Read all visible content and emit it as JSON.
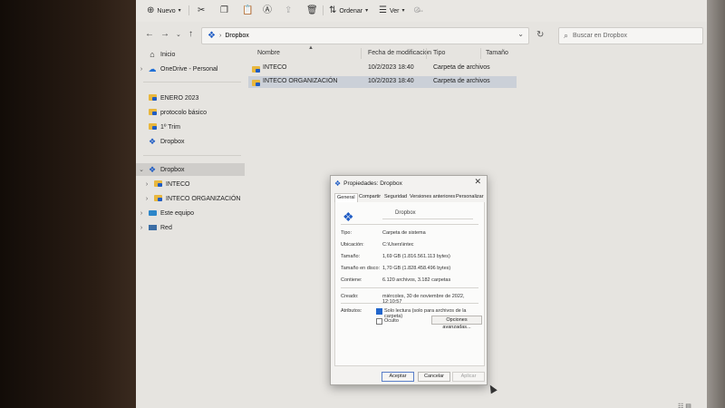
{
  "toolbar": {
    "new_label": "Nuevo",
    "sort_label": "Ordenar",
    "view_label": "Ver",
    "more_label": "···"
  },
  "address": {
    "path": "Dropbox",
    "search_placeholder": "Buscar en Dropbox"
  },
  "nav_pane": {
    "items": [
      {
        "label": "Inicio"
      },
      {
        "label": "OneDrive - Personal"
      },
      {
        "label": "ENERO 2023"
      },
      {
        "label": "protocolo básico"
      },
      {
        "label": "1º Trim"
      },
      {
        "label": "Dropbox"
      },
      {
        "label": "Dropbox"
      },
      {
        "label": "INTECO"
      },
      {
        "label": "INTECO ORGANIZACIÓN"
      },
      {
        "label": "Este equipo"
      },
      {
        "label": "Red"
      }
    ]
  },
  "list": {
    "columns": [
      "Nombre",
      "Fecha de modificación",
      "Tipo",
      "Tamaño"
    ],
    "rows": [
      {
        "name": "INTECO",
        "date": "10/2/2023 18:40",
        "type": "Carpeta de archivos"
      },
      {
        "name": "INTECO ORGANIZACIÓN",
        "date": "10/2/2023 18:40",
        "type": "Carpeta de archivos"
      }
    ]
  },
  "dialog": {
    "title": "Propiedades: Dropbox",
    "close": "✕",
    "tabs": [
      "General",
      "Compartir",
      "Seguridad",
      "Versiones anteriores",
      "Personalizar"
    ],
    "name": "Dropbox",
    "props": [
      {
        "label": "Tipo:",
        "value": "Carpeta de sistema"
      },
      {
        "label": "Ubicación:",
        "value": "C:\\Users\\intec"
      },
      {
        "label": "Tamaño:",
        "value": "1,69 GB (1.816.561.113 bytes)"
      },
      {
        "label": "Tamaño en disco:",
        "value": "1,70 GB (1.828.458.496 bytes)"
      },
      {
        "label": "Contiene:",
        "value": "6.120 archivos, 3.182 carpetas"
      },
      {
        "label": "Creado:",
        "value": "miércoles, 30 de noviembre de 2022, 12:10:57"
      }
    ],
    "attributes_label": "Atributos:",
    "readonly_label": "Solo lectura (solo para archivos de la carpeta)",
    "hidden_label": "Oculto",
    "advanced_label": "Opciones avanzadas...",
    "ok": "Aceptar",
    "cancel": "Cancelar",
    "apply": "Aplicar"
  }
}
